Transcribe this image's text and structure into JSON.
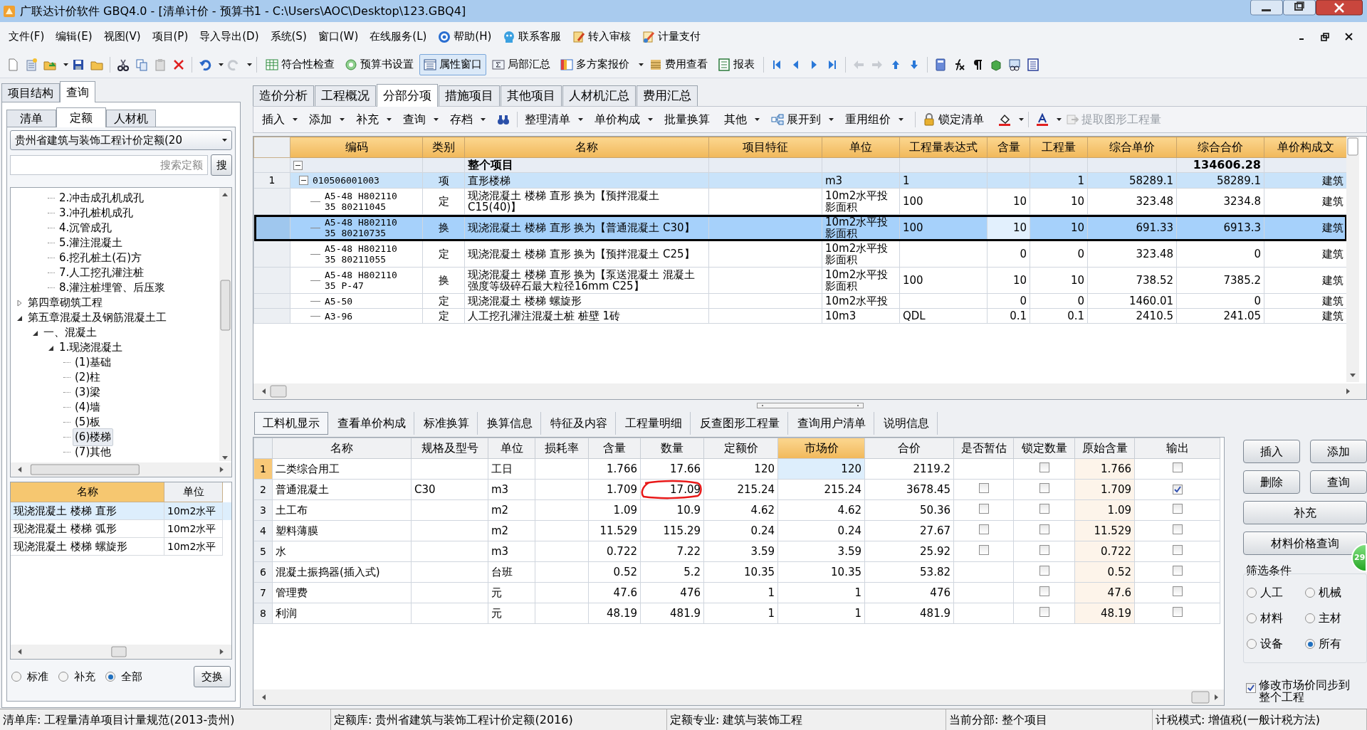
{
  "window": {
    "title": "广联达计价软件 GBQ4.0 - [清单计价 - 预算书1 - C:\\Users\\AOC\\Desktop\\123.GBQ4]"
  },
  "menu": [
    {
      "label": "文件(F)",
      "kind": "plain"
    },
    {
      "label": "编辑(E)",
      "kind": "plain"
    },
    {
      "label": "视图(V)",
      "kind": "plain"
    },
    {
      "label": "项目(P)",
      "kind": "plain"
    },
    {
      "label": "导入导出(D)",
      "kind": "plain"
    },
    {
      "label": "系统(S)",
      "kind": "plain"
    },
    {
      "label": "窗口(W)",
      "kind": "plain"
    },
    {
      "label": "在线服务(L)",
      "kind": "plain"
    },
    {
      "label": "帮助(H)",
      "kind": "icon"
    },
    {
      "label": "联系客服",
      "kind": "icon"
    },
    {
      "label": "转入审核",
      "kind": "icon"
    },
    {
      "label": "计量支付",
      "kind": "icon"
    }
  ],
  "toolbar": [
    {
      "label": "符合性检查",
      "pressed": false,
      "dropdown": false
    },
    {
      "label": "预算书设置",
      "pressed": false,
      "dropdown": false
    },
    {
      "label": "属性窗口",
      "pressed": true,
      "dropdown": false
    },
    {
      "label": "局部汇总",
      "pressed": false,
      "dropdown": false
    },
    {
      "label": "多方案报价",
      "pressed": false,
      "dropdown": true
    },
    {
      "label": "费用查看",
      "pressed": false,
      "dropdown": false
    },
    {
      "label": "报表",
      "pressed": false,
      "dropdown": false
    }
  ],
  "left_panel": {
    "tabs": [
      {
        "label": "项目结构",
        "selected": false
      },
      {
        "label": "查询",
        "selected": true
      }
    ],
    "sub_tabs": [
      {
        "label": "清单",
        "selected": false
      },
      {
        "label": "定额",
        "selected": true
      },
      {
        "label": "人材机",
        "selected": false
      }
    ],
    "library": "贵州省建筑与装饰工程计价定额(20",
    "search": {
      "placeholder": "搜索定额",
      "button": "搜"
    },
    "tree": [
      {
        "children": [
          {
            "children": [
              {
                "label": "2.冲击成孔机成孔",
                "selected": false
              },
              {
                "label": "3.冲孔桩机成孔",
                "selected": false
              },
              {
                "label": "4.沉管成孔",
                "selected": false
              },
              {
                "label": "5.灌注混凝土",
                "selected": false
              },
              {
                "label": "6.挖孔桩土(石)方",
                "selected": false
              },
              {
                "label": "7.人工挖孔灌注桩",
                "selected": false
              },
              {
                "label": "8.灌注桩埋管、后压浆",
                "selected": false
              }
            ]
          }
        ]
      },
      {
        "label": "第四章砌筑工程",
        "expanded": false,
        "selected": false
      },
      {
        "label": "第五章混凝土及钢筋混凝土工",
        "expanded": true,
        "selected": false,
        "children": [
          {
            "label": "一、混凝土",
            "expanded": true,
            "selected": false,
            "children": [
              {
                "label": "1.现浇混凝土",
                "expanded": true,
                "selected": false,
                "children": [
                  {
                    "label": "(1)基础",
                    "selected": false
                  },
                  {
                    "label": "(2)柱",
                    "selected": false
                  },
                  {
                    "label": "(3)梁",
                    "selected": false
                  },
                  {
                    "label": "(4)墙",
                    "selected": false
                  },
                  {
                    "label": "(5)板",
                    "selected": false
                  },
                  {
                    "label": "(6)楼梯",
                    "selected": true
                  },
                  {
                    "label": "(7)其他",
                    "selected": false
                  }
                ]
              }
            ]
          }
        ]
      }
    ],
    "list": {
      "columns": [
        "名称",
        "单位"
      ],
      "rows": [
        {
          "cells": [
            "现浇混凝土 楼梯 直形",
            "10m2水平"
          ],
          "selected": true
        },
        {
          "cells": [
            "现浇混凝土 楼梯 弧形",
            "10m2水平"
          ],
          "selected": false
        },
        {
          "cells": [
            "现浇混凝土 楼梯 螺旋形",
            "10m2水平"
          ],
          "selected": false
        }
      ]
    },
    "scope": [
      {
        "label": "标准",
        "selected": false
      },
      {
        "label": "补充",
        "selected": false
      },
      {
        "label": "全部",
        "selected": true
      }
    ],
    "swap_button": "交换"
  },
  "tabs": [
    {
      "label": "造价分析",
      "selected": false
    },
    {
      "label": "工程概况",
      "selected": false
    },
    {
      "label": "分部分项",
      "selected": true
    },
    {
      "label": "措施项目",
      "selected": false
    },
    {
      "label": "其他项目",
      "selected": false
    },
    {
      "label": "人材机汇总",
      "selected": false
    },
    {
      "label": "费用汇总",
      "selected": false
    }
  ],
  "sub_toolbar": [
    {
      "label": "插入",
      "dropdown": true,
      "kind": "text"
    },
    {
      "label": "添加",
      "dropdown": true,
      "kind": "text"
    },
    {
      "label": "补充",
      "dropdown": true,
      "kind": "text"
    },
    {
      "label": "查询",
      "dropdown": true,
      "kind": "text"
    },
    {
      "label": "存档",
      "dropdown": true,
      "kind": "text"
    },
    {
      "kind": "find"
    },
    {
      "label": "整理清单",
      "dropdown": true,
      "kind": "text"
    },
    {
      "label": "单价构成",
      "dropdown": true,
      "kind": "text"
    },
    {
      "label": "批量换算",
      "dropdown": false,
      "kind": "text"
    },
    {
      "label": "其他",
      "dropdown": true,
      "kind": "text"
    },
    {
      "label": "展开到",
      "dropdown": true,
      "kind": "tree"
    },
    {
      "label": "重用组价",
      "dropdown": true,
      "kind": "text"
    },
    {
      "label": "锁定清单",
      "dropdown": false,
      "kind": "lock"
    },
    {
      "kind": "fill",
      "dropdown": true
    },
    {
      "kind": "font",
      "dropdown": true
    },
    {
      "label": "提取图形工程量",
      "dropdown": false,
      "kind": "extract",
      "disabled": true
    }
  ],
  "bill_table": {
    "columns": [
      "编码",
      "类别",
      "名称",
      "项目特征",
      "单位",
      "工程量表达式",
      "含量",
      "工程量",
      "综合单价",
      "综合合价",
      "单价构成文"
    ],
    "rows": [
      {
        "kind": "group",
        "expanded": true,
        "selected": false,
        "cells": [
          "",
          "",
          "整个项目",
          "",
          "",
          "",
          "",
          "",
          "",
          "134606.28",
          ""
        ]
      },
      {
        "kind": "item",
        "number": "1",
        "expanded": true,
        "selected": false,
        "cells": [
          "010506001003",
          "项",
          "直形楼梯",
          "",
          "m3",
          "1",
          "",
          "1",
          "58289.1",
          "58289.1",
          "建筑"
        ]
      },
      {
        "kind": "sub",
        "selected": false,
        "cells": [
          "A5-48 H80211035 80211045",
          "定",
          "现浇混凝土 楼梯 直形  换为【预拌混凝土 C15(40)】",
          "",
          "10m2水平投影面积",
          "100",
          "10",
          "10",
          "323.48",
          "3234.8",
          "建筑"
        ]
      },
      {
        "kind": "sub",
        "selected": true,
        "cells": [
          "A5-48 H80211035 80210735",
          "换",
          "现浇混凝土 楼梯 直形  换为【普通混凝土 C30】",
          "",
          "10m2水平投影面积",
          "100",
          "10",
          "10",
          "691.33",
          "6913.3",
          "建筑"
        ]
      },
      {
        "kind": "sub",
        "selected": false,
        "cells": [
          "A5-48 H80211035 80211055",
          "定",
          "现浇混凝土 楼梯 直形  换为【预拌混凝土 C25】",
          "",
          "10m2水平投影面积",
          "",
          "0",
          "0",
          "323.48",
          "0",
          "建筑"
        ]
      },
      {
        "kind": "sub",
        "selected": false,
        "cells": [
          "A5-48 H80211035 P-47",
          "换",
          "现浇混凝土 楼梯 直形  换为【泵送混凝土 混凝土强度等级碎石最大粒径16mm C25】",
          "",
          "10m2水平投影面积",
          "100",
          "10",
          "10",
          "738.52",
          "7385.2",
          "建筑"
        ]
      },
      {
        "kind": "sub",
        "selected": false,
        "cells": [
          "A5-50",
          "定",
          "现浇混凝土 楼梯 螺旋形",
          "",
          "10m2水平投",
          "",
          "0",
          "0",
          "1460.01",
          "0",
          "建筑"
        ]
      },
      {
        "kind": "sub",
        "selected": false,
        "cells": [
          "A3-96",
          "定",
          "人工挖孔灌注混凝土桩 桩壁 1砖",
          "",
          "10m3",
          "QDL",
          "0.1",
          "0.1",
          "2410.5",
          "241.05",
          "建筑"
        ]
      }
    ]
  },
  "detail_tabs": [
    {
      "label": "工料机显示",
      "selected": true
    },
    {
      "label": "查看单价构成",
      "selected": false
    },
    {
      "label": "标准换算",
      "selected": false
    },
    {
      "label": "换算信息",
      "selected": false
    },
    {
      "label": "特征及内容",
      "selected": false
    },
    {
      "label": "工程量明细",
      "selected": false
    },
    {
      "label": "反查图形工程量",
      "selected": false
    },
    {
      "label": "查询用户清单",
      "selected": false
    },
    {
      "label": "说明信息",
      "selected": false
    }
  ],
  "resource_table": {
    "columns": [
      "名称",
      "规格及型号",
      "单位",
      "损耗率",
      "含量",
      "数量",
      "定额价",
      "市场价",
      "合价",
      "是否暂估",
      "锁定数量",
      "原始含量",
      "输出"
    ],
    "rows": [
      {
        "number": "1",
        "cells": [
          "二类综合用工",
          "",
          "工日",
          "",
          "1.766",
          "17.66",
          "120",
          "120",
          "2119.2"
        ],
        "locked": false,
        "original": "1.766",
        "output": false,
        "circled": false
      },
      {
        "number": "2",
        "cells": [
          "普通混凝土",
          "C30",
          "m3",
          "",
          "1.709",
          "17.09",
          "215.24",
          "215.24",
          "3678.45"
        ],
        "estimate": false,
        "locked": false,
        "original": "1.709",
        "output": true,
        "circled": true
      },
      {
        "number": "3",
        "cells": [
          "土工布",
          "",
          "m2",
          "",
          "1.09",
          "10.9",
          "4.62",
          "4.62",
          "50.36"
        ],
        "estimate": false,
        "locked": false,
        "original": "1.09",
        "output": false,
        "circled": false
      },
      {
        "number": "4",
        "cells": [
          "塑料薄膜",
          "",
          "m2",
          "",
          "11.529",
          "115.29",
          "0.24",
          "0.24",
          "27.67"
        ],
        "estimate": false,
        "locked": false,
        "original": "11.529",
        "output": false,
        "circled": false
      },
      {
        "number": "5",
        "cells": [
          "水",
          "",
          "m3",
          "",
          "0.722",
          "7.22",
          "3.59",
          "3.59",
          "25.92"
        ],
        "estimate": false,
        "locked": false,
        "original": "0.722",
        "output": false,
        "circled": false
      },
      {
        "number": "6",
        "cells": [
          "混凝土振捣器(插入式)",
          "",
          "台班",
          "",
          "0.52",
          "5.2",
          "10.35",
          "10.35",
          "53.82"
        ],
        "locked": false,
        "original": "0.52",
        "output": false,
        "circled": false
      },
      {
        "number": "7",
        "cells": [
          "管理费",
          "",
          "元",
          "",
          "47.6",
          "476",
          "1",
          "1",
          "476"
        ],
        "locked": false,
        "original": "47.6",
        "output": false,
        "circled": false
      },
      {
        "number": "8",
        "cells": [
          "利润",
          "",
          "元",
          "",
          "48.19",
          "481.9",
          "1",
          "1",
          "481.9"
        ],
        "locked": false,
        "original": "48.19",
        "output": false,
        "circled": false
      }
    ]
  },
  "side_buttons": [
    "插入",
    "添加",
    "删除",
    "查询",
    "补充",
    "材料价格查询"
  ],
  "filter": {
    "title": "筛选条件",
    "options": [
      {
        "label": "人工",
        "selected": false
      },
      {
        "label": "机械",
        "selected": false
      },
      {
        "label": "材料",
        "selected": false
      },
      {
        "label": "主材",
        "selected": false
      },
      {
        "label": "设备",
        "selected": false
      },
      {
        "label": "所有",
        "selected": true
      }
    ]
  },
  "sync_option": {
    "label": "修改市场价同步到整个工程",
    "checked": true
  },
  "floating_badge": "29",
  "status_bar": [
    "清单库: 工程量清单项目计量规范(2013-贵州)",
    "定额库: 贵州省建筑与装饰工程计价定额(2016)",
    "定额专业: 建筑与装饰工程",
    "当前分部: 整个项目",
    "计税模式: 增值税(一般计税方法)"
  ]
}
